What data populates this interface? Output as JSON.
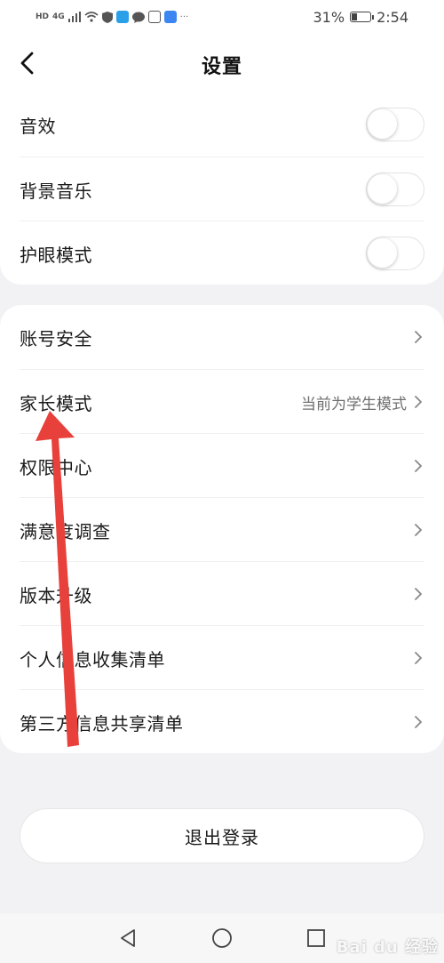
{
  "status_bar": {
    "network_label": "HD",
    "signal_label": "4G",
    "battery_percent": "31%",
    "battery_level": 0.31,
    "time": "2:54",
    "overflow": "···"
  },
  "header": {
    "title": "设置",
    "back_icon": "chevron-left-icon"
  },
  "toggles": [
    {
      "label": "音效",
      "on": false
    },
    {
      "label": "背景音乐",
      "on": false
    },
    {
      "label": "护眼模式",
      "on": false
    }
  ],
  "menu": [
    {
      "label": "账号安全",
      "value": ""
    },
    {
      "label": "家长模式",
      "value": "当前为学生模式"
    },
    {
      "label": "权限中心",
      "value": ""
    },
    {
      "label": "满意度调查",
      "value": ""
    },
    {
      "label": "版本升级",
      "value": ""
    },
    {
      "label": "个人信息收集清单",
      "value": ""
    },
    {
      "label": "第三方信息共享清单",
      "value": ""
    }
  ],
  "logout_label": "退出登录",
  "watermark": "Bai du 经验",
  "colors": {
    "annotation_arrow": "#e8413b",
    "background": "#f2f2f4",
    "card": "#ffffff"
  }
}
